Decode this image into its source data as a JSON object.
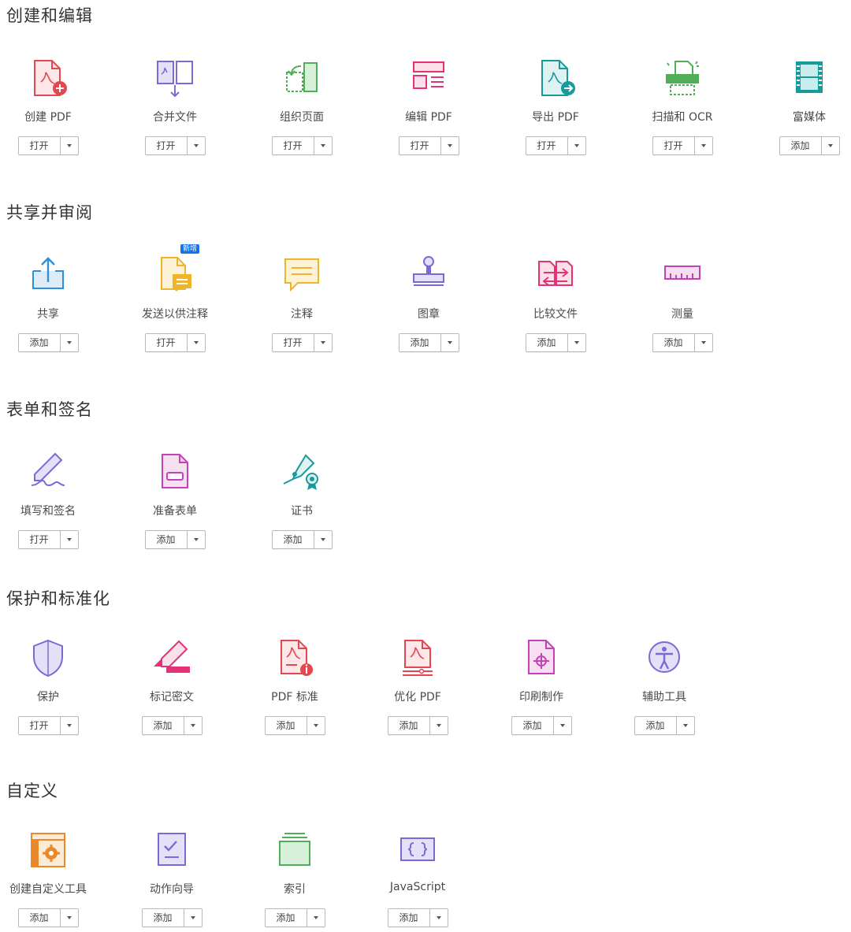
{
  "sections": [
    {
      "title": "创建和编辑",
      "tools": [
        {
          "label": "创建 PDF",
          "button": "打开",
          "icon": "create-pdf-icon"
        },
        {
          "label": "合并文件",
          "button": "打开",
          "icon": "combine-files-icon"
        },
        {
          "label": "组织页面",
          "button": "打开",
          "icon": "organize-pages-icon"
        },
        {
          "label": "编辑 PDF",
          "button": "打开",
          "icon": "edit-pdf-icon"
        },
        {
          "label": "导出 PDF",
          "button": "打开",
          "icon": "export-pdf-icon"
        },
        {
          "label": "扫描和 OCR",
          "button": "打开",
          "icon": "scan-ocr-icon"
        },
        {
          "label": "富媒体",
          "button": "添加",
          "icon": "rich-media-icon"
        }
      ]
    },
    {
      "title": "共享并审阅",
      "tools": [
        {
          "label": "共享",
          "button": "添加",
          "icon": "share-icon"
        },
        {
          "label": "发送以供注释",
          "button": "打开",
          "icon": "send-for-comment-icon",
          "badge": "新增"
        },
        {
          "label": "注释",
          "button": "打开",
          "icon": "comment-icon"
        },
        {
          "label": "图章",
          "button": "添加",
          "icon": "stamp-icon"
        },
        {
          "label": "比较文件",
          "button": "添加",
          "icon": "compare-files-icon"
        },
        {
          "label": "测量",
          "button": "添加",
          "icon": "measure-icon"
        }
      ]
    },
    {
      "title": "表单和签名",
      "tools": [
        {
          "label": "填写和签名",
          "button": "打开",
          "icon": "fill-sign-icon"
        },
        {
          "label": "准备表单",
          "button": "添加",
          "icon": "prepare-form-icon"
        },
        {
          "label": "证书",
          "button": "添加",
          "icon": "certificates-icon"
        }
      ]
    },
    {
      "title": "保护和标准化",
      "tools": [
        {
          "label": "保护",
          "button": "打开",
          "icon": "protect-icon"
        },
        {
          "label": "标记密文",
          "button": "添加",
          "icon": "redact-icon"
        },
        {
          "label": "PDF 标准",
          "button": "添加",
          "icon": "pdf-standards-icon"
        },
        {
          "label": "优化 PDF",
          "button": "添加",
          "icon": "optimize-pdf-icon"
        },
        {
          "label": "印刷制作",
          "button": "添加",
          "icon": "print-production-icon"
        },
        {
          "label": "辅助工具",
          "button": "添加",
          "icon": "accessibility-icon"
        }
      ]
    },
    {
      "title": "自定义",
      "tools": [
        {
          "label": "创建自定义工具",
          "button": "添加",
          "icon": "custom-tool-icon"
        },
        {
          "label": "动作向导",
          "button": "添加",
          "icon": "action-wizard-icon"
        },
        {
          "label": "索引",
          "button": "添加",
          "icon": "index-icon"
        },
        {
          "label": "JavaScript",
          "button": "添加",
          "icon": "javascript-icon"
        }
      ]
    }
  ],
  "colors": {
    "red": "#e34850",
    "purple": "#7b6ad6",
    "green": "#4fae57",
    "pink": "#e3317a",
    "teal": "#179a9c",
    "yellow": "#f0b429",
    "blue": "#2f8fd8",
    "magenta": "#c541b5"
  }
}
